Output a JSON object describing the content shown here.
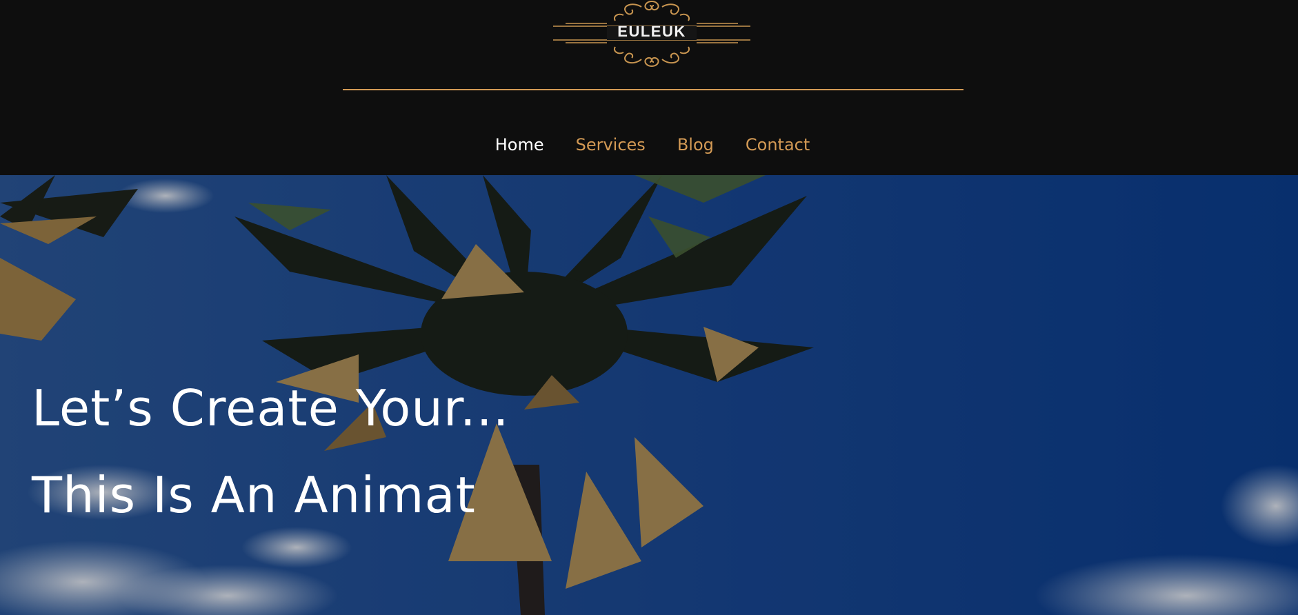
{
  "brand": {
    "logo_text": "EULEUK",
    "accent_color": "#d39a55"
  },
  "nav": {
    "items": [
      {
        "label": "Home",
        "active": true
      },
      {
        "label": "Services",
        "active": false
      },
      {
        "label": "Blog",
        "active": false
      },
      {
        "label": "Contact",
        "active": false
      }
    ]
  },
  "hero": {
    "headline": "Let’s Create Your...",
    "animated_text": "This Is An Animat",
    "background": "palm-tree-sky-photo"
  }
}
